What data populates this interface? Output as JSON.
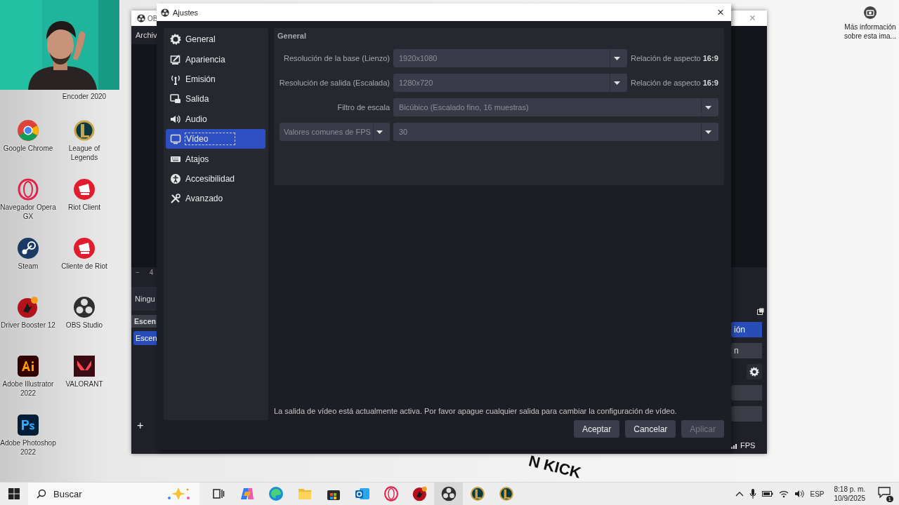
{
  "desktop": {
    "icons": [
      {
        "label": "Encoder 2020",
        "kind": "hidden"
      },
      {
        "label": "Google Chrome",
        "kind": "chrome"
      },
      {
        "label": "League of Legends",
        "kind": "lol"
      },
      {
        "label": "Navegador Opera GX",
        "kind": "opera"
      },
      {
        "label": "Riot Client",
        "kind": "riot"
      },
      {
        "label": "Steam",
        "kind": "steam"
      },
      {
        "label": "Cliente de Riot",
        "kind": "riot"
      },
      {
        "label": "Driver Booster 12",
        "kind": "booster"
      },
      {
        "label": "OBS Studio",
        "kind": "obs"
      },
      {
        "label": "Adobe Illustrator 2022",
        "kind": "ai"
      },
      {
        "label": "VALORANT",
        "kind": "valorant"
      },
      {
        "label": "Adobe Photoshop 2022",
        "kind": "ps"
      }
    ],
    "info_link": "Más información sobre esta ima...",
    "wallpaper_text": "N KICK"
  },
  "obs_window": {
    "title": "OB",
    "close": "×",
    "menu": [
      "Archiv"
    ],
    "left_panel": {
      "zoom_minus": "−",
      "zoom_value": "4",
      "source_text": "Ningu",
      "scenes_header": "Escen",
      "scenes": [
        {
          "label": "Escen",
          "selected": true
        }
      ],
      "add": "+"
    },
    "right_panel": {
      "buttons": [
        {
          "label": "ión",
          "kind": "primary"
        },
        {
          "label": "n",
          "kind": "plain"
        },
        {
          "kind": "gear"
        },
        {
          "kind": "plain"
        },
        {
          "kind": "plain"
        }
      ],
      "status": "FPS"
    }
  },
  "dialog": {
    "title": "Ajustes",
    "close": "×",
    "sidebar": [
      {
        "label": "General",
        "kind": "gear",
        "selected": false
      },
      {
        "label": "Apariencia",
        "kind": "brush",
        "selected": false
      },
      {
        "label": "Emisión",
        "kind": "antenna",
        "selected": false
      },
      {
        "label": "Salida",
        "kind": "output",
        "selected": false
      },
      {
        "label": "Audio",
        "kind": "speaker",
        "selected": false
      },
      {
        "label": "Vídeo",
        "kind": "monitor",
        "selected": true
      },
      {
        "label": "Atajos",
        "kind": "keyboard",
        "selected": false
      },
      {
        "label": "Accesibilidad",
        "kind": "access",
        "selected": false
      },
      {
        "label": "Avanzado",
        "kind": "tools",
        "selected": false
      }
    ],
    "group_title": "General",
    "rows": [
      {
        "kind": "labeled",
        "label": "Resolución de la base (Lienzo)",
        "value": "1920x1080",
        "disabled": true,
        "aspect": "Relación de aspecto **16:9**"
      },
      {
        "kind": "labeled",
        "label": "Resolución de salida (Escalada)",
        "value": "1280x720",
        "disabled": true,
        "aspect": "Relación de aspecto **16:9**"
      },
      {
        "kind": "labeled",
        "label": "Filtro de escala",
        "value": "Bicúbico (Escalado fino, 16 muestras)",
        "disabled": true
      },
      {
        "kind": "combo",
        "label": "Valores comunes de FPS",
        "value": "30",
        "disabled": true
      }
    ],
    "message": "La salida de vídeo está actualmente activa. Por favor apague cualquier salida para cambiar la configuración de vídeo.",
    "buttons": [
      {
        "label": "Aceptar",
        "disabled": false
      },
      {
        "label": "Cancelar",
        "disabled": false
      },
      {
        "label": "Aplicar",
        "disabled": true
      }
    ]
  },
  "taskbar": {
    "search": "Buscar",
    "apps": [
      {
        "kind": "taskview",
        "selected": false
      },
      {
        "kind": "copilot",
        "selected": false
      },
      {
        "kind": "edge",
        "selected": false
      },
      {
        "kind": "explorer",
        "selected": false
      },
      {
        "kind": "store",
        "selected": false
      },
      {
        "kind": "outlook",
        "selected": false
      },
      {
        "kind": "opera",
        "selected": false
      },
      {
        "kind": "booster",
        "selected": false
      },
      {
        "kind": "obs",
        "selected": true
      },
      {
        "kind": "lol",
        "selected": false
      },
      {
        "kind": "lol",
        "selected": false
      }
    ],
    "language": "ESP",
    "time": "8:18 p. m.",
    "date": "10/9/2025",
    "notifications": "1"
  }
}
